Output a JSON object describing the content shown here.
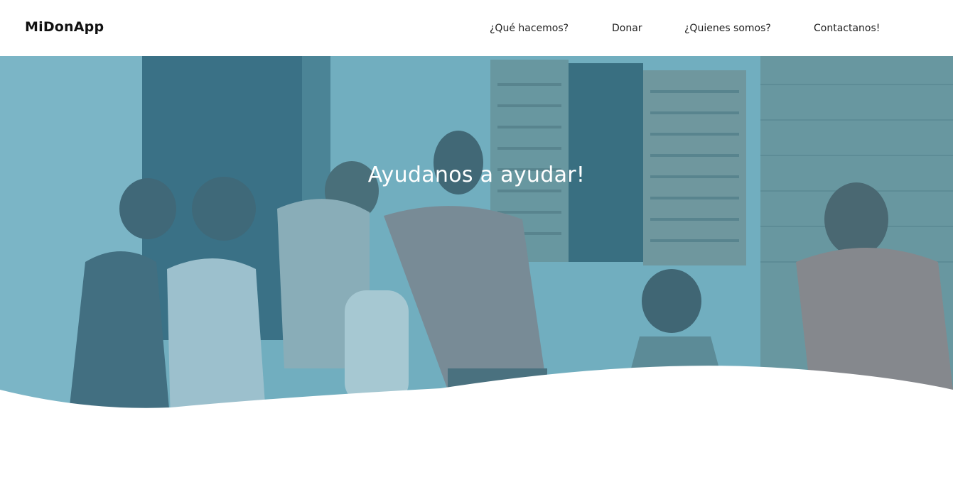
{
  "brand": {
    "name": "MiDonApp"
  },
  "nav": {
    "items": [
      {
        "label": "¿Qué hacemos?"
      },
      {
        "label": "Donar"
      },
      {
        "label": "¿Quienes somos?"
      },
      {
        "label": "Contactanos!"
      }
    ]
  },
  "hero": {
    "title": "Ayudanos a ayudar!",
    "overlay_color": "#5fa3b8"
  }
}
